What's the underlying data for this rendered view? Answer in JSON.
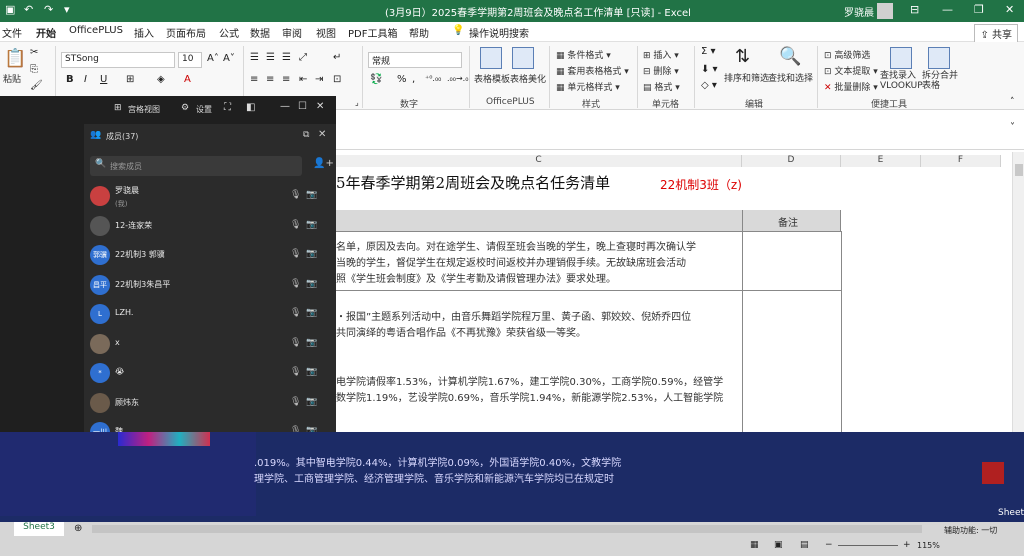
{
  "titlebar": {
    "title": "(3月9日）2025春季学期第2周班会及晚点名工作清单 [只读] - Excel",
    "user": "罗骁晨"
  },
  "tabs": [
    "文件",
    "开始",
    "OfficePLUS",
    "插入",
    "页面布局",
    "公式",
    "数据",
    "审阅",
    "视图",
    "PDF工具箱",
    "帮助",
    "操作说明搜索"
  ],
  "share": "共享",
  "ribbon": {
    "font_name": "STSong",
    "font_size": "10",
    "number_format": "常规",
    "paste": "粘贴",
    "wrap_label": "换行",
    "group_labels": [
      "数字",
      "OfficePLUS",
      "样式",
      "单元格",
      "编辑",
      "便捷工具"
    ],
    "officeplus": [
      "表格模板",
      "表格美化"
    ],
    "styles": [
      "条件格式",
      "套用表格格式",
      "单元格样式"
    ],
    "cells": [
      "插入",
      "删除",
      "格式"
    ],
    "editing": [
      "排序和筛选",
      "查找和选择"
    ],
    "tools": [
      "高级筛选",
      "文本提取",
      "批量删除",
      "查找录入 VLOOKUP",
      "拆分合并 表格"
    ]
  },
  "sheet": {
    "col_headers": [
      "C",
      "D",
      "E",
      "F"
    ],
    "title": "5年春季学期第2周班会及晚点名任务清单",
    "class_tag": "22机制3班（z)",
    "remark_header": "备注",
    "lines": [
      "名单，原因及去向。对在途学生、请假至班会当晚的学生，晚上查寝时再次确认学",
      "当晚的学生，督促学生在规定返校时间返校并办理销假手续。无故缺席班会活动",
      "照《学生班会制度》及《学生考勤及请假管理办法》要求处理。",
      "・报国”主题系列活动中，由音乐舞蹈学院程万里、黄子函、郭姣姣、倪娇乔四位",
      "共同演绎的粤语合唱作品《不再犹豫》荣获省级一等奖。",
      "电学院请假率1.53%，计算机学院1.67%，建工学院0.30%，工商学院0.59%，经管学",
      "数学院1.19%，艺设学院0.69%，音乐学院1.94%，新能源学院2.53%，人工智能学院"
    ]
  },
  "meeting": {
    "gallery": "宫格视图",
    "settings": "设置",
    "members_title": "成员(37)",
    "search_placeholder": "搜索成员",
    "members": [
      {
        "name": "罗骁晨",
        "sub": "(我)",
        "color": "#c94040"
      },
      {
        "name": "12-连家荣",
        "sub": "",
        "color": "#555555"
      },
      {
        "name": "22机制3 郭骥",
        "sub": "",
        "color": "#2f6fd0",
        "av": "郭骥"
      },
      {
        "name": "22机制3朱昌平",
        "sub": "",
        "color": "#2f6fd0",
        "av": "昌平"
      },
      {
        "name": "LZH.",
        "sub": "",
        "color": "#2f6fd0",
        "av": "L"
      },
      {
        "name": "x",
        "sub": "",
        "color": "#7a6a5a"
      },
      {
        "name": "😭",
        "sub": "",
        "color": "#2f6fd0",
        "av": "*"
      },
      {
        "name": "顾炜东",
        "sub": "",
        "color": "#6a5a4a"
      },
      {
        "name": "魏...",
        "sub": "",
        "color": "#2f6fd0",
        "av": "一川"
      }
    ]
  },
  "lower": {
    "line1": ".019%。其中智电学院0.44%，计算机学院0.09%，外国语学院0.40%，文教学院",
    "line2": "理学院、工商管理学院、经济管理学院、音乐学院和新能源汽车学院均已在规定时"
  },
  "status": {
    "sheet_tab": "Sheet3",
    "right_tab": "Sheet",
    "zoom": "115%",
    "aux": "辅助功能: 一切"
  }
}
